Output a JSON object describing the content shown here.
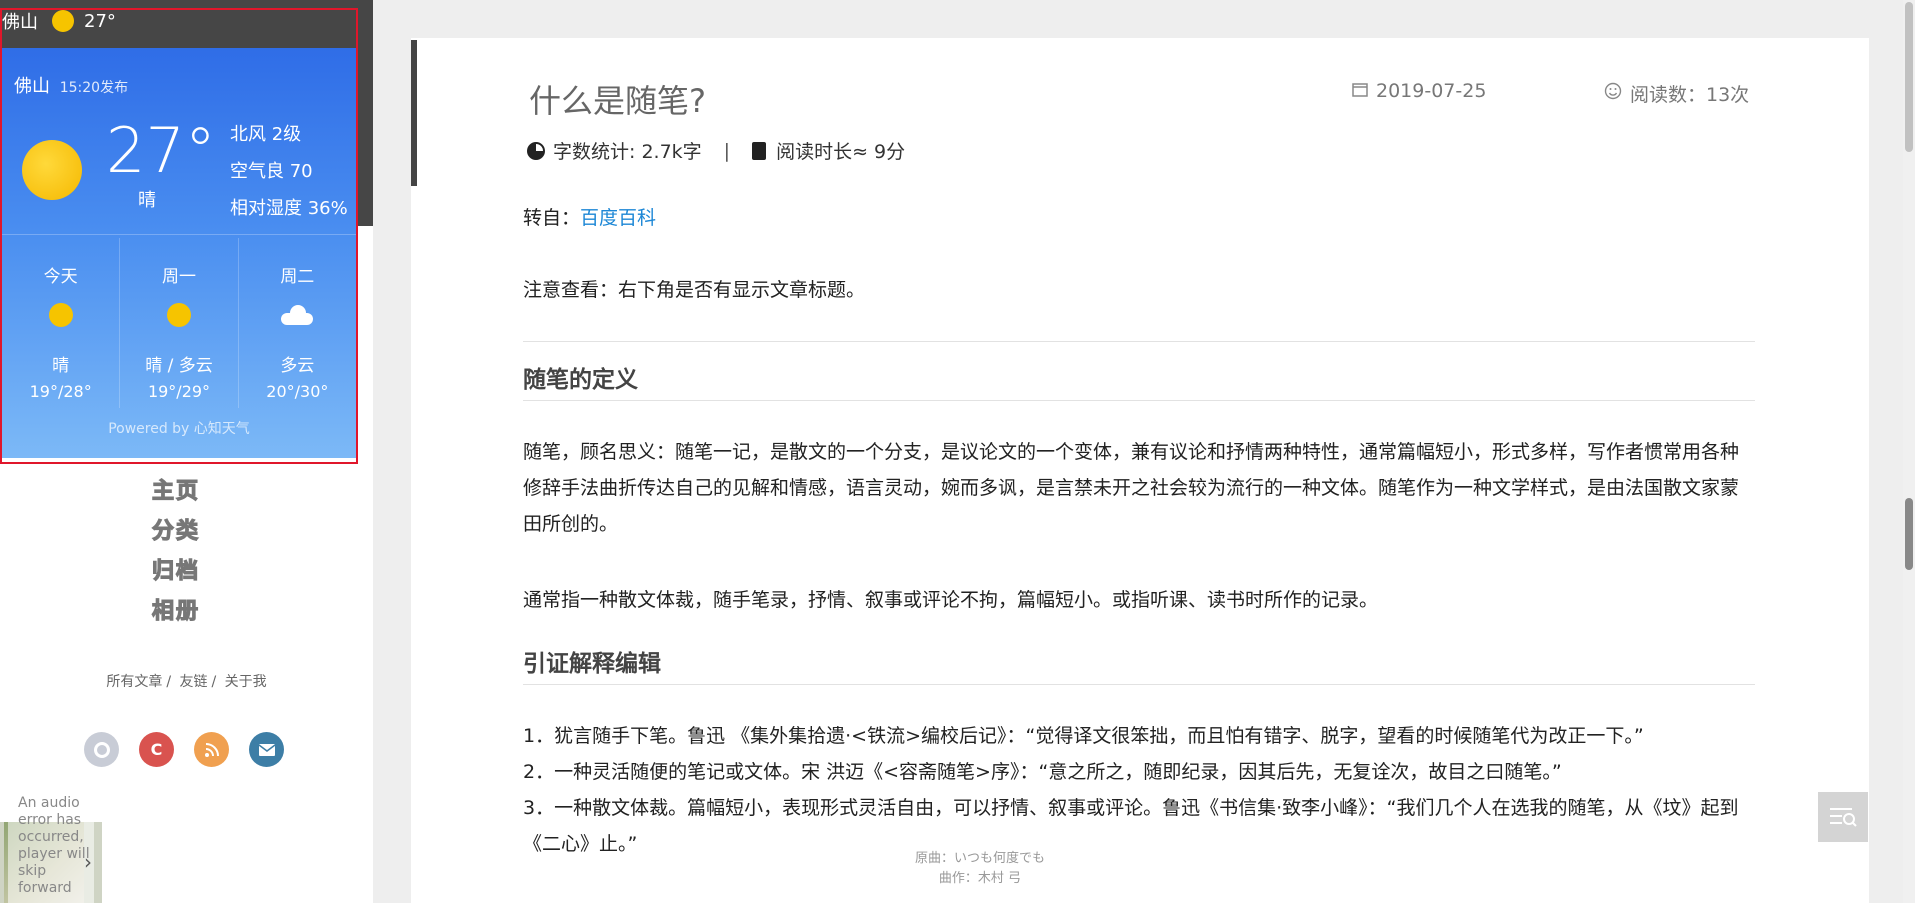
{
  "weather_bar": {
    "city": "佛山",
    "temp": "27°"
  },
  "weather_card": {
    "city": "佛山",
    "published": "15:20发布",
    "temp": "27°",
    "condition": "晴",
    "wind": "北风 2级",
    "air": "空气良 70",
    "humidity": "相对湿度 36%",
    "forecast": [
      {
        "day": "今天",
        "icon": "sun-icon",
        "cond": "晴",
        "range": "19°/28°"
      },
      {
        "day": "周一",
        "icon": "sun-icon",
        "cond": "晴 / 多云",
        "range": "19°/29°"
      },
      {
        "day": "周二",
        "icon": "cloud-icon",
        "cond": "多云",
        "range": "20°/30°"
      }
    ],
    "powered": "Powered by 心知天气"
  },
  "nav": {
    "home": "主页",
    "categories": "分类",
    "archives": "归档",
    "album": "相册"
  },
  "sub_links": {
    "all_posts": "所有文章",
    "friends": "友链",
    "about": "关于我",
    "sep": "/"
  },
  "social": {
    "github": "github-icon",
    "csdn": "C",
    "rss": "rss-icon",
    "mail": "mail-icon"
  },
  "audio": {
    "error": "An audio error has occurred, player will skip forward"
  },
  "article": {
    "title": "什么是随笔?",
    "date": "2019-07-25",
    "reads": "阅读数：13次",
    "word_count": "字数统计: 2.7k字",
    "separator": "|",
    "read_time": "阅读时长≈ 9分",
    "source_label": "转自：",
    "source_link": "百度百科",
    "note": "注意查看：右下角是否有显示文章标题。",
    "h_def": "随笔的定义",
    "def1": "随笔，顾名思义：随笔一记，是散文的一个分支，是议论文的一个变体，兼有议论和抒情两种特性，通常篇幅短小，形式多样，写作者惯常用各种修辞手法曲折传达自己的见解和情感，语言灵动，婉而多讽，是言禁未开之社会较为流行的一种文体。随笔作为一种文学样式，是由法国散文家蒙田所创的。",
    "def2": "通常指一种散文体裁，随手笔录，抒情、叙事或评论不拘，篇幅短小。或指听课、读书时所作的记录。",
    "h_cite": "引证解释编辑",
    "list": [
      "1．犹言随手下笔。鲁迅 《集外集拾遗·<铁流>编校后记》：“觉得译文很笨拙，而且怕有错字、脱字，望看的时候随笔代为改正一下。”",
      "2．一种灵活随便的笔记或文体。宋 洪迈《<容斋随笔>序》：“意之所之，随即纪录，因其后先，无复诠次，故目之曰随笔。”",
      "3．一种散文体裁。篇幅短小，表现形式灵活自由，可以抒情、叙事或评论。鲁迅《书信集·致李小峰》：“我们几个人在选我的随笔，从《坟》起到《二心》止。”"
    ]
  },
  "lyrics": {
    "line1": "原曲：いつも何度でも",
    "line2": "曲作：木村 弓"
  }
}
